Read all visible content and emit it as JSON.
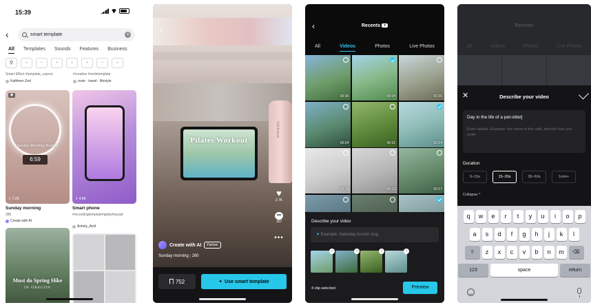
{
  "phone1": {
    "status_time": "15:39",
    "search_value": "smart template",
    "tabs": [
      "All",
      "Templates",
      "Sounds",
      "Features",
      "Business"
    ],
    "active_tab": "All",
    "filter_chips": [
      "⚲",
      "-",
      "-",
      "-",
      "-",
      "-",
      "-",
      "-"
    ],
    "prev_row": {
      "left_title": "Smart Effect #template_capcut",
      "left_author": "Kathleen Zed",
      "right_title": "#creative #reelstemplate",
      "right_author": "rosie · travel · lifestyle"
    },
    "cards": [
      {
        "overlay": "Sunday Morning Routine",
        "clock": "6:59",
        "count": "7.2K",
        "title": "Sunday morning",
        "sub": "280",
        "author": "Create with AI"
      },
      {
        "count": "4.6K",
        "title": "Smart phone",
        "sub": "#recordingtemplate#ppfashioyasf",
        "author": "Ashely_Avril"
      },
      {
        "overlay_main": "Must do Spring Hike",
        "overlay_sub": "IN OREGON"
      },
      {}
    ]
  },
  "phone2": {
    "tablet_text": "Pilates Workout",
    "bottle_label": "lululemon",
    "likes": "2.7K",
    "comments": "167",
    "creator": "Create with AI",
    "creator_badge": "Partner",
    "video_title": "Sunday morning",
    "video_uses": "280",
    "save_count": "752",
    "use_label": "Use smart template"
  },
  "phone3": {
    "title": "Recents",
    "tabs": [
      "All",
      "Videos",
      "Photos",
      "Live Photos"
    ],
    "active_tab": "Videos",
    "tiles": [
      {
        "dur": "00:35",
        "sel": false,
        "bg": "linear-gradient(160deg,#86b4d9,#6f9d6a 55%,#3f6b3a)"
      },
      {
        "dur": "00:04",
        "sel": true,
        "bg": "linear-gradient(160deg,#a3d3ea,#89b98a 50%,#4f8a4e)"
      },
      {
        "dur": "00:36",
        "sel": false,
        "bg": "linear-gradient(160deg,#c7d6d8,#9aa08d 55%,#6a6a55)"
      },
      {
        "dur": "00:24",
        "sel": false,
        "bg": "linear-gradient(160deg,#7fb0c8,#5a8a6f 55%,#2e4d3c)"
      },
      {
        "dur": "00:01",
        "sel": false,
        "bg": "linear-gradient(160deg,#93b76d,#5e8a3b 55%,#3a5e22)"
      },
      {
        "dur": "00:14",
        "sel": true,
        "bg": "linear-gradient(160deg,#b7d9de,#8fbdb8 50%,#5d8f8a)"
      },
      {
        "dur": "00:15",
        "sel": false,
        "bg": "linear-gradient(160deg,#e8e8e8,#cfcfcf 55%,#aaaaaa)"
      },
      {
        "dur": "00:12",
        "sel": false,
        "bg": "linear-gradient(160deg,#d8d8d8,#b6b6b6 55%,#8f8f8f)"
      },
      {
        "dur": "00:17",
        "sel": false,
        "bg": "linear-gradient(160deg,#94b7a0,#668a6b 55%,#3f5e45)"
      },
      {
        "dur": "",
        "sel": false,
        "bg": "linear-gradient(160deg,#7d9dab,#5b7683 55%,#33444d)"
      },
      {
        "dur": "",
        "sel": false,
        "bg": "linear-gradient(160deg,#6b7f6e,#4f6152 55%,#2c3a2e)"
      },
      {
        "dur": "",
        "sel": true,
        "bg": "linear-gradient(160deg,#a9c4c7,#7f9a9c 55%,#556f72)"
      }
    ],
    "panel_title": "Describe your video",
    "placeholder": "Example: Saturday brunch vlog",
    "thumbs": [
      "linear-gradient(160deg,#a3d3ea,#6f9d6a)",
      "linear-gradient(160deg,#7fb0c8,#3f6b3a)",
      "linear-gradient(160deg,#93b76d,#3a5e22)",
      "linear-gradient(160deg,#b7d9de,#5d8f8a)"
    ],
    "selected_text": "4 clip selected",
    "preview_label": "Preview"
  },
  "phone4": {
    "ghost_title": "Recents",
    "ghost_tabs": [
      "All",
      "Videos",
      "Photos",
      "Live Photos"
    ],
    "sheet_title": "Describe your video",
    "desc_value": "Day in the life of a pet-sitter",
    "desc_hint": "Enter details. Example: the name of the café, and the food you order",
    "duration_label": "Duration",
    "durations": [
      "0–15s",
      "15–30s",
      "30–60s",
      "1min+"
    ],
    "active_duration": "15–30s",
    "collapse_label": "Collapse ^",
    "keyboard": {
      "row1": [
        "q",
        "w",
        "e",
        "r",
        "t",
        "y",
        "u",
        "i",
        "o",
        "p"
      ],
      "row2": [
        "a",
        "s",
        "d",
        "f",
        "g",
        "h",
        "j",
        "k",
        "l"
      ],
      "row3": [
        "z",
        "x",
        "c",
        "v",
        "b",
        "n",
        "m"
      ],
      "shift": "⇧",
      "delete": "⌫",
      "num": "123",
      "space": "space",
      "return": "return"
    }
  }
}
